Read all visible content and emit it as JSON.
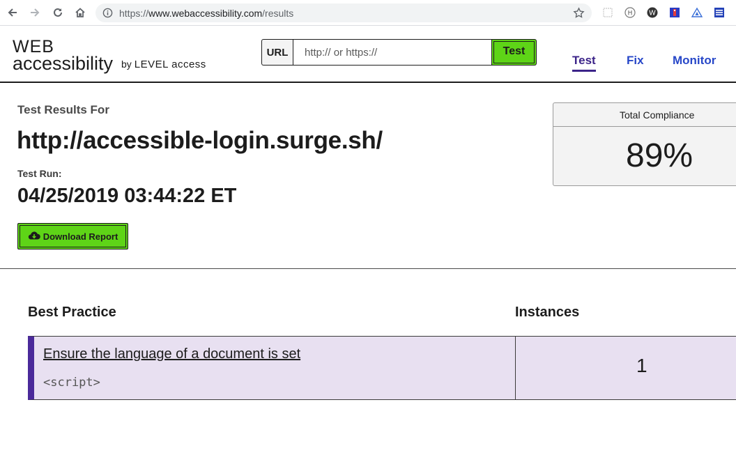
{
  "browser": {
    "url_scheme": "https://",
    "url_host": "www.webaccessibility.com",
    "url_path": "/results",
    "nav_icons": [
      "back-arrow-icon",
      "forward-arrow-icon",
      "reload-icon",
      "home-icon"
    ],
    "extension_icons": [
      "extension-dotted-icon",
      "headings-h-icon",
      "wappalyzer-w-icon",
      "extension-flag-icon",
      "triangle-tool-icon",
      "list-lines-icon"
    ]
  },
  "header": {
    "logo_web": "WEB",
    "logo_accessibility": "accessibility",
    "logo_by": "by",
    "logo_level_access": "LEVEL access",
    "url_label": "URL",
    "url_placeholder": "http:// or https://",
    "test_button": "Test",
    "nav": [
      {
        "label": "Test",
        "active": true
      },
      {
        "label": "Fix",
        "active": false
      },
      {
        "label": "Monitor",
        "active": false
      }
    ]
  },
  "results": {
    "results_for_label": "Test Results For",
    "tested_url": "http://accessible-login.surge.sh/",
    "test_run_label": "Test Run:",
    "test_run_date": "04/25/2019 03:44:22 ET",
    "download_button": "Download Report"
  },
  "compliance": {
    "title": "Total Compliance",
    "value": "89%"
  },
  "table": {
    "headers": {
      "practice": "Best Practice",
      "instances": "Instances"
    },
    "rows": [
      {
        "title": "Ensure the language of a document is set",
        "code": "<script>",
        "instances": "1"
      }
    ]
  },
  "colors": {
    "accent_green": "#5ed417",
    "nav_blue": "#2747c8",
    "nav_active_purple": "#3c2489",
    "row_bg": "#e8e0f1",
    "row_accent": "#4b2a9a"
  }
}
